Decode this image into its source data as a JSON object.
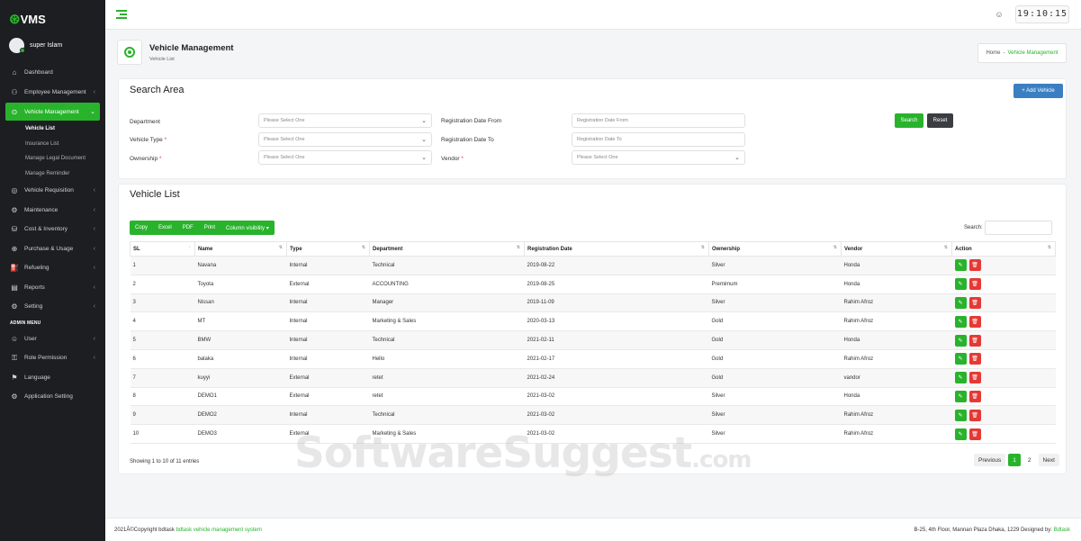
{
  "app": {
    "logo_text": "VMS",
    "user_name": "super Islam"
  },
  "sidebar": {
    "items": [
      {
        "label": "Dashboard",
        "icon": "home-icon"
      },
      {
        "label": "Employee Management",
        "icon": "users-icon",
        "has_children": true
      },
      {
        "label": "Vehicle Management",
        "icon": "vehicle-icon",
        "has_children": true,
        "active": true
      }
    ],
    "sub_items": [
      {
        "label": "Vehicle List",
        "current": true
      },
      {
        "label": "Insurance List"
      },
      {
        "label": "Manage Legal Document"
      },
      {
        "label": "Manage Reminder"
      }
    ],
    "items2": [
      {
        "label": "Vehicle Requisition",
        "icon": "requisition-icon"
      },
      {
        "label": "Maintenance",
        "icon": "maintenance-icon"
      },
      {
        "label": "Cost & Inventory",
        "icon": "cost-icon"
      },
      {
        "label": "Purchase & Usage",
        "icon": "purchase-icon"
      },
      {
        "label": "Refueling",
        "icon": "fuel-icon"
      },
      {
        "label": "Reports",
        "icon": "reports-icon"
      },
      {
        "label": "Setting",
        "icon": "setting-icon"
      }
    ],
    "admin_section": "ADMIN MENU",
    "admin_items": [
      {
        "label": "User",
        "icon": "user-icon",
        "has_children": true
      },
      {
        "label": "Role Permission",
        "icon": "role-icon",
        "has_children": true
      },
      {
        "label": "Language",
        "icon": "flag-icon"
      },
      {
        "label": "Application Setting",
        "icon": "gear-icon"
      }
    ]
  },
  "topbar": {
    "clock": "19:10:15"
  },
  "page_header": {
    "title": "Vehicle Management",
    "subtitle": "Vehicle List"
  },
  "breadcrumb": {
    "home": "Home",
    "separator": "-",
    "current": "Vehicle Management"
  },
  "search_area": {
    "title": "Search Area",
    "add_button": "+ Add Vehicle",
    "department_label": "Department",
    "department_placeholder": "Please Select One",
    "vehicle_type_label": "Vehicle Type",
    "vehicle_type_placeholder": "Please Select One",
    "ownership_label": "Ownership",
    "ownership_placeholder": "Please Select One",
    "reg_from_label": "Registration Date From",
    "reg_from_placeholder": "Registration Date From",
    "reg_to_label": "Registration Date To",
    "reg_to_placeholder": "Registration Date To",
    "vendor_label": "Vendor",
    "vendor_placeholder": "Please Select One",
    "required_mark": "*",
    "search_button": "Search",
    "reset_button": "Reset"
  },
  "vehicle_list": {
    "title": "Vehicle List",
    "export_buttons": [
      "Copy",
      "Excel",
      "PDF",
      "Print",
      "Column visibility ▾"
    ],
    "search_label": "Search:",
    "columns": [
      "SL",
      "Name",
      "Type",
      "Department",
      "Registration Date",
      "Ownership",
      "Vendor",
      "Action"
    ],
    "rows": [
      [
        "1",
        "Navana",
        "Internal",
        "Technical",
        "2019-08-22",
        "Silver",
        "Honda"
      ],
      [
        "2",
        "Toyota",
        "External",
        "ACCOUNTING",
        "2019-08-25",
        "Premimum",
        "Honda"
      ],
      [
        "3",
        "Nissan",
        "Internal",
        "Manager",
        "2019-11-09",
        "Silver",
        "Rahim Afroz"
      ],
      [
        "4",
        "MT",
        "Internal",
        "Marketing & Sales",
        "2020-03-13",
        "Gold",
        "Rahim Afroz"
      ],
      [
        "5",
        "BMW",
        "Internal",
        "Technical",
        "2021-02-11",
        "Gold",
        "Honda"
      ],
      [
        "6",
        "balaka",
        "Internal",
        "Hello",
        "2021-02-17",
        "Gold",
        "Rahim Afroz"
      ],
      [
        "7",
        "kuyyi",
        "External",
        "retet",
        "2021-02-24",
        "Gold",
        "vandor"
      ],
      [
        "8",
        "DEMO1",
        "External",
        "retet",
        "2021-03-02",
        "Silver",
        "Honda"
      ],
      [
        "9",
        "DEMO2",
        "Internal",
        "Technical",
        "2021-03-02",
        "Silver",
        "Rahim Afroz"
      ],
      [
        "10",
        "DEMO3",
        "External",
        "Marketing & Sales",
        "2021-03-02",
        "Silver",
        "Rahim Afroz"
      ]
    ],
    "info": "Showing 1 to 10 of 11 entries",
    "pager": {
      "prev": "Previous",
      "pages": [
        "1",
        "2"
      ],
      "next": "Next"
    }
  },
  "footer": {
    "copyright": "2021Â©Copyright bdtask",
    "link": "bdtask vehicle management system",
    "address": "B-25, 4th Floor, Mannan Plaza Dhaka, 1229 Designed by:",
    "designer": "Bdtask"
  },
  "watermark": {
    "text": "SoftwareSuggest",
    "suffix": ".com"
  },
  "colors": {
    "accent": "#29b32c",
    "sidebar_bg": "#1c1e21",
    "danger": "#e53935",
    "primary": "#3a7fc1"
  }
}
